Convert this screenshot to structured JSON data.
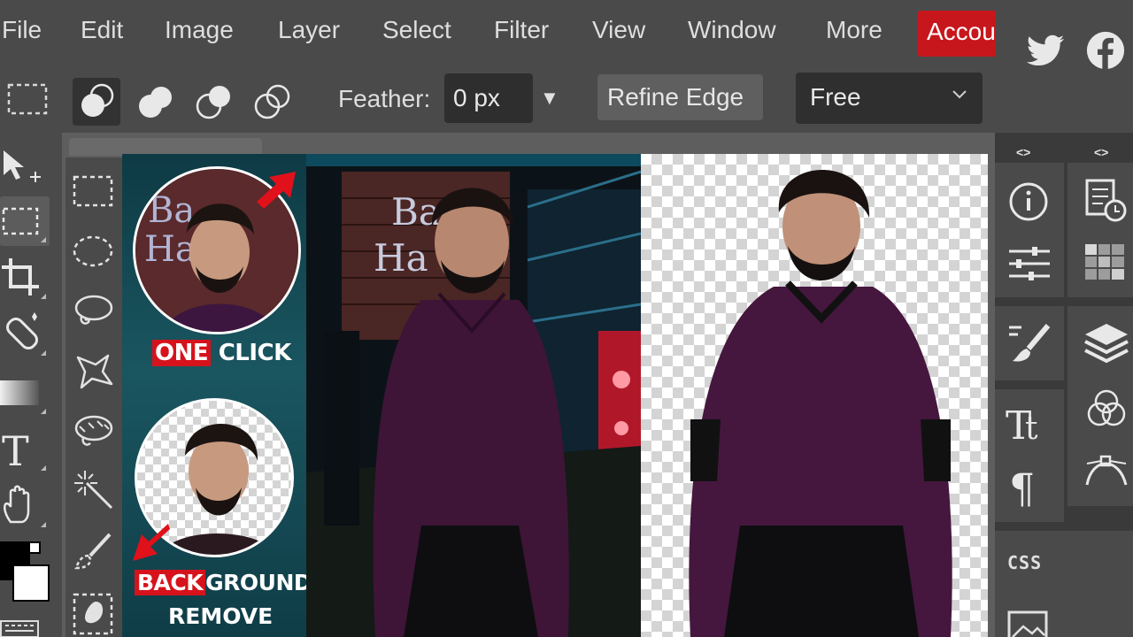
{
  "menu": {
    "items": [
      "File",
      "Edit",
      "Image",
      "Layer",
      "Select",
      "Filter",
      "View",
      "Window",
      "More"
    ],
    "account": "Accou"
  },
  "options": {
    "feather_label": "Feather:",
    "feather_value": "0 px",
    "refine_edge": "Refine Edge",
    "mode_value": "Free"
  },
  "right_panel": {
    "collapse_left": "<>",
    "collapse_right": "<>",
    "css_label": "CSS"
  },
  "canvas": {
    "thumb_top_caption_highlight": "ONE",
    "thumb_top_caption_rest": "CLICK",
    "thumb_bottom_caption_highlight": "BACK",
    "thumb_bottom_caption_rest": "GROUND",
    "thumb_bottom_caption_line2": "REMOVE"
  },
  "colors": {
    "accent": "#c8161d",
    "ui_bg": "#4a4a4a",
    "panel_bg": "#3a3a3a"
  },
  "social": [
    "twitter-icon",
    "facebook-icon"
  ]
}
